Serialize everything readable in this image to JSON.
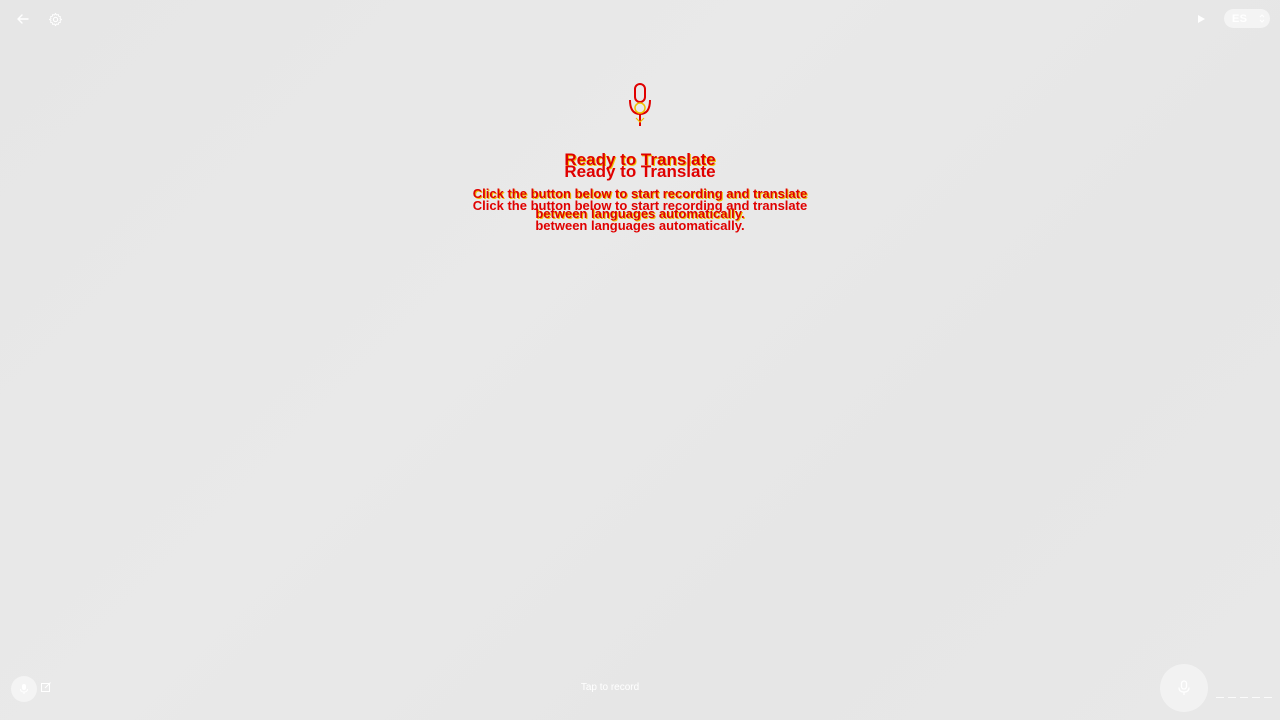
{
  "topbar": {
    "back_icon": "arrow-left-icon",
    "settings_icon": "gear-icon",
    "play_icon": "play-icon",
    "language": "ES"
  },
  "hero": {
    "icon": "microphone-icon",
    "title": "Ready to Translate",
    "description": "Click the button below to start recording and translate between languages automatically."
  },
  "bottombar": {
    "mic_icon": "microphone-icon",
    "edit_icon": "edit-icon",
    "status_label": "Tap to record",
    "record_icon": "microphone-icon"
  },
  "colors": {
    "background": "#e8e8e8",
    "text_accent": "#e00000",
    "text_shadow": "#f0c000",
    "icon": "#ffffff"
  }
}
